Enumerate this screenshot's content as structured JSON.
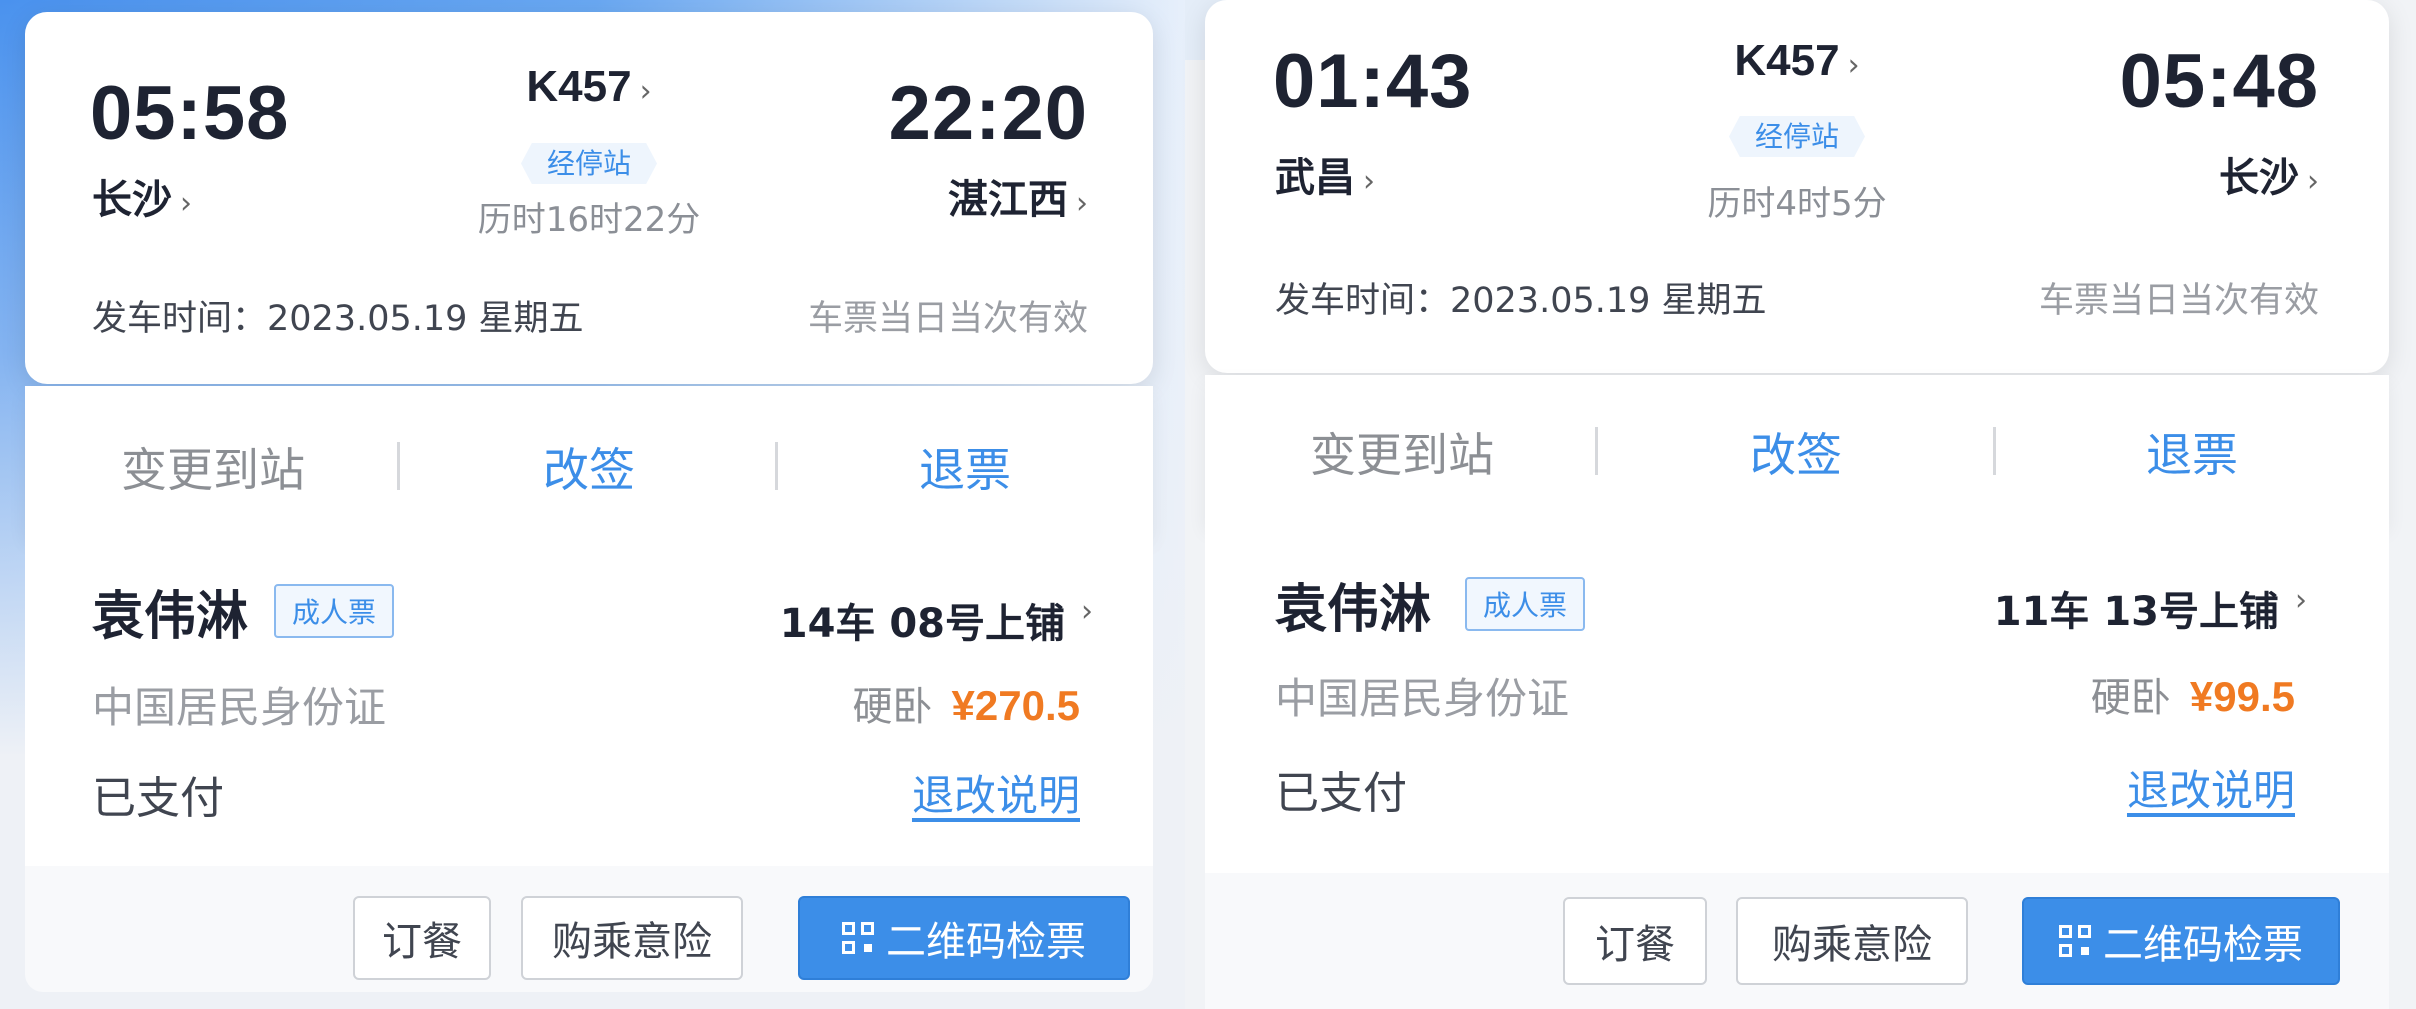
{
  "tickets": [
    {
      "depart_time": "05:58",
      "arrive_time": "22:20",
      "train_no": "K457",
      "from_station": "长沙",
      "to_station": "湛江西",
      "stops_label": "经停站",
      "duration": "历时16时22分",
      "depart_date_label": "发车时间：2023.05.19 星期五",
      "validity": "车票当日当次有效",
      "actions": {
        "change_station": "变更到站",
        "reschedule": "改签",
        "refund": "退票"
      },
      "passenger": {
        "name": "袁伟淋",
        "ticket_type": "成人票",
        "seat": "14车 08号上铺",
        "id_type": "中国居民身份证",
        "seat_class": "硬卧",
        "price": "¥270.5",
        "status": "已支付",
        "rules_link": "退改说明"
      },
      "buttons": {
        "meal": "订餐",
        "insurance": "购乘意险",
        "qr_check": "二维码检票"
      }
    },
    {
      "depart_time": "01:43",
      "arrive_time": "05:48",
      "train_no": "K457",
      "from_station": "武昌",
      "to_station": "长沙",
      "stops_label": "经停站",
      "duration": "历时4时5分",
      "depart_date_label": "发车时间：2023.05.19 星期五",
      "validity": "车票当日当次有效",
      "actions": {
        "change_station": "变更到站",
        "reschedule": "改签",
        "refund": "退票"
      },
      "passenger": {
        "name": "袁伟淋",
        "ticket_type": "成人票",
        "seat": "11车 13号上铺",
        "id_type": "中国居民身份证",
        "seat_class": "硬卧",
        "price": "¥99.5",
        "status": "已支付",
        "rules_link": "退改说明"
      },
      "buttons": {
        "meal": "订餐",
        "insurance": "购乘意险",
        "qr_check": "二维码检票"
      }
    }
  ],
  "icons": [
    "chevron-right-icon",
    "qr-code-icon"
  ],
  "colors": {
    "accent": "#3c8ee8",
    "price": "#f07a22",
    "header_blue": "#4a92ee"
  }
}
